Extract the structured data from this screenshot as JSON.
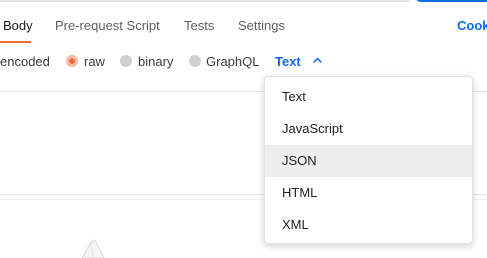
{
  "tabs": {
    "body": "Body",
    "prerequest": "Pre-request Script",
    "tests": "Tests",
    "settings": "Settings",
    "cookies": "Cook"
  },
  "body_modes": {
    "encoded": "encoded",
    "raw": "raw",
    "binary": "binary",
    "graphql": "GraphQL",
    "selected_mode": "raw",
    "language_selector": "Text"
  },
  "dropdown": {
    "options": [
      "Text",
      "JavaScript",
      "JSON",
      "HTML",
      "XML"
    ],
    "highlighted": "JSON"
  },
  "colors": {
    "accent": "#f26b3a",
    "link": "#0b6cf0"
  },
  "icons": {
    "chevron": "chevron-up-icon",
    "illustration": "empty-state-illustration"
  }
}
